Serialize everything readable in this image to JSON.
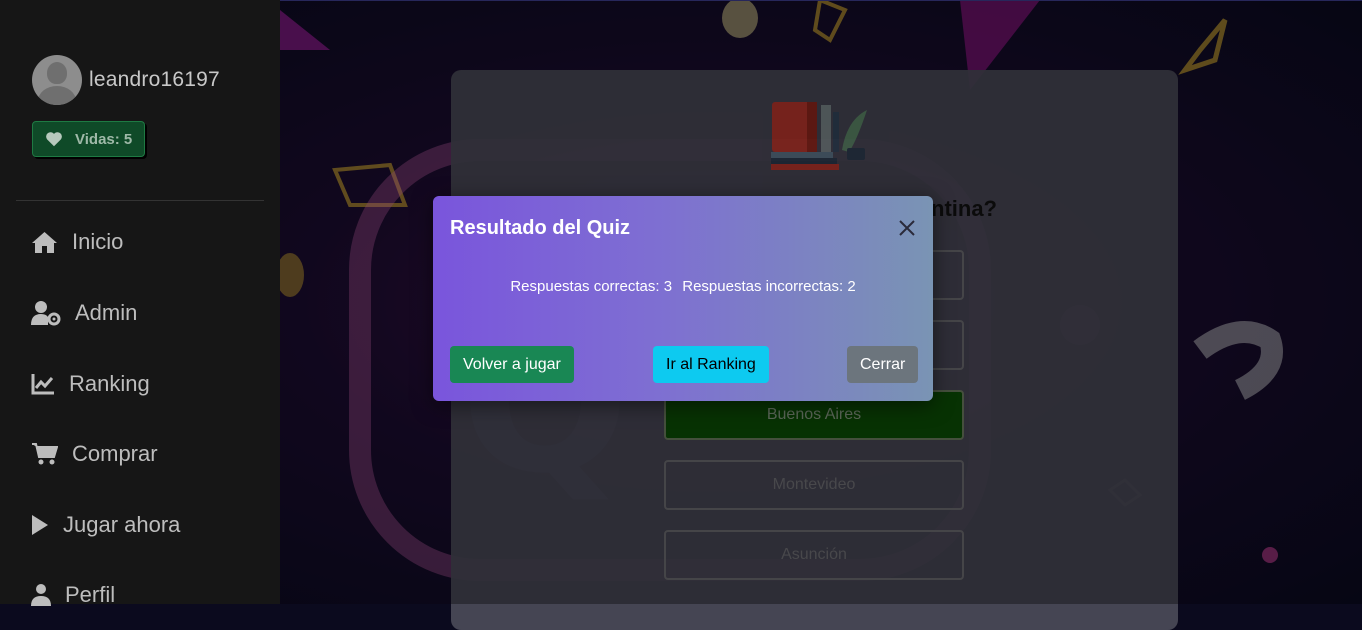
{
  "user": {
    "name": "leandro16197",
    "lives_label": "Vidas: 5"
  },
  "nav": [
    {
      "label": "Inicio",
      "icon": "home-icon"
    },
    {
      "label": "Admin",
      "icon": "user-gear-icon"
    },
    {
      "label": "Ranking",
      "icon": "chart-line-icon"
    },
    {
      "label": "Comprar",
      "icon": "cart-icon"
    },
    {
      "label": "Jugar ahora",
      "icon": "play-icon"
    },
    {
      "label": "Perfil",
      "icon": "user-icon"
    }
  ],
  "quiz": {
    "question_fragment": "ntina?",
    "answers": [
      {
        "label": "",
        "state": "neutral"
      },
      {
        "label": "",
        "state": "neutral"
      },
      {
        "label": "Buenos Aires",
        "state": "correct"
      },
      {
        "label": "Montevideo",
        "state": "neutral"
      },
      {
        "label": "Asunción",
        "state": "neutral"
      }
    ]
  },
  "modal": {
    "title": "Resultado del Quiz",
    "correct_text": "Respuestas correctas: 3",
    "incorrect_text": "Respuestas incorrectas: 2",
    "replay_label": "Volver a jugar",
    "ranking_label": "Ir al Ranking",
    "close_label": "Cerrar"
  },
  "colors": {
    "sidebar_bg": "#161616",
    "lives_bg": "#0f4a28",
    "modal_gradient_start": "#7a55dc",
    "modal_gradient_end": "#7a94b4",
    "btn_success": "#198754",
    "btn_info": "#0dcaf0",
    "btn_secondary": "#6c757d",
    "correct_answer_bg": "#0b4d06"
  }
}
